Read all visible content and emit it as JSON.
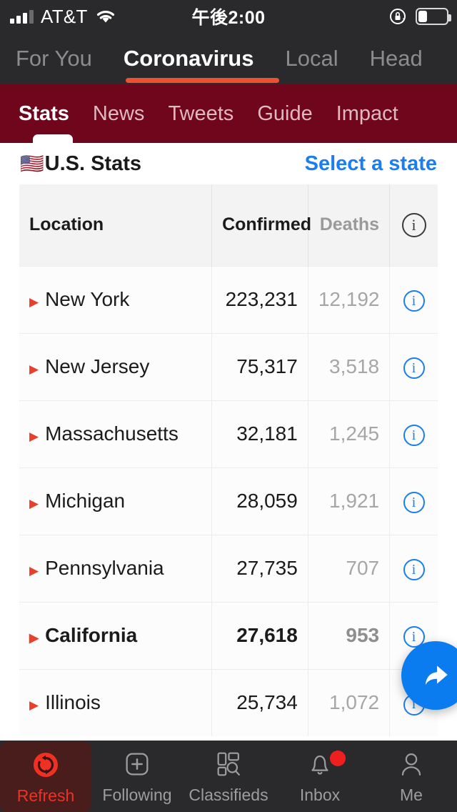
{
  "statusbar": {
    "carrier": "AT&T",
    "time": "午後2:00",
    "signal_icon": "cellular-bars-icon",
    "wifi_icon": "wifi-icon",
    "rotation_lock_icon": "rotation-lock-icon",
    "battery_icon": "battery-icon",
    "battery_level_percent": 32
  },
  "top_tabs": {
    "items": [
      {
        "label": "For You",
        "active": false
      },
      {
        "label": "Coronavirus",
        "active": true
      },
      {
        "label": "Local",
        "active": false
      },
      {
        "label": "Head",
        "active": false
      }
    ],
    "accent_color": "#f0502f"
  },
  "sub_nav": {
    "background_color": "#70061b",
    "items": [
      {
        "label": "Stats",
        "active": true
      },
      {
        "label": "News",
        "active": false
      },
      {
        "label": "Tweets",
        "active": false
      },
      {
        "label": "Guide",
        "active": false
      },
      {
        "label": "Impact",
        "active": false
      }
    ]
  },
  "page_header": {
    "flag_icon": "us-flag-icon",
    "title": "U.S. Stats",
    "select_state_label": "Select a state",
    "link_color": "#1a7ef0"
  },
  "table": {
    "columns": [
      {
        "key": "location",
        "label": "Location"
      },
      {
        "key": "confirmed",
        "label": "Confirmed"
      },
      {
        "key": "deaths",
        "label": "Deaths"
      },
      {
        "key": "info",
        "label": "",
        "icon": "info-circle-icon"
      }
    ],
    "rows": [
      {
        "location": "New York",
        "confirmed": "223,231",
        "deaths": "12,192",
        "highlighted": false,
        "bullet_icon": "triangle-right-icon",
        "row_info_icon": "info-circle-icon"
      },
      {
        "location": "New Jersey",
        "confirmed": "75,317",
        "deaths": "3,518",
        "highlighted": false,
        "bullet_icon": "triangle-right-icon",
        "row_info_icon": "info-circle-icon"
      },
      {
        "location": "Massachusetts",
        "confirmed": "32,181",
        "deaths": "1,245",
        "highlighted": false,
        "bullet_icon": "triangle-right-icon",
        "row_info_icon": "info-circle-icon"
      },
      {
        "location": "Michigan",
        "confirmed": "28,059",
        "deaths": "1,921",
        "highlighted": false,
        "bullet_icon": "triangle-right-icon",
        "row_info_icon": "info-circle-icon"
      },
      {
        "location": "Pennsylvania",
        "confirmed": "27,735",
        "deaths": "707",
        "highlighted": false,
        "bullet_icon": "triangle-right-icon",
        "row_info_icon": "info-circle-icon"
      },
      {
        "location": "California",
        "confirmed": "27,618",
        "deaths": "953",
        "highlighted": true,
        "bullet_icon": "triangle-right-icon",
        "row_info_icon": "info-circle-icon"
      },
      {
        "location": "Illinois",
        "confirmed": "25,734",
        "deaths": "1,072",
        "highlighted": false,
        "bullet_icon": "triangle-right-icon",
        "row_info_icon": "info-circle-icon"
      }
    ]
  },
  "fab": {
    "icon": "share-arrow-icon",
    "color": "#0a7cf0"
  },
  "bottom_tabs": {
    "items": [
      {
        "label": "Refresh",
        "icon": "refresh-icon",
        "active": true,
        "badge": false
      },
      {
        "label": "Following",
        "icon": "plus-square-icon",
        "active": false,
        "badge": false
      },
      {
        "label": "Classifieds",
        "icon": "grid-search-icon",
        "active": false,
        "badge": false
      },
      {
        "label": "Inbox",
        "icon": "bell-icon",
        "active": false,
        "badge": true
      },
      {
        "label": "Me",
        "icon": "person-icon",
        "active": false,
        "badge": false
      }
    ],
    "active_color": "#ef3124"
  }
}
